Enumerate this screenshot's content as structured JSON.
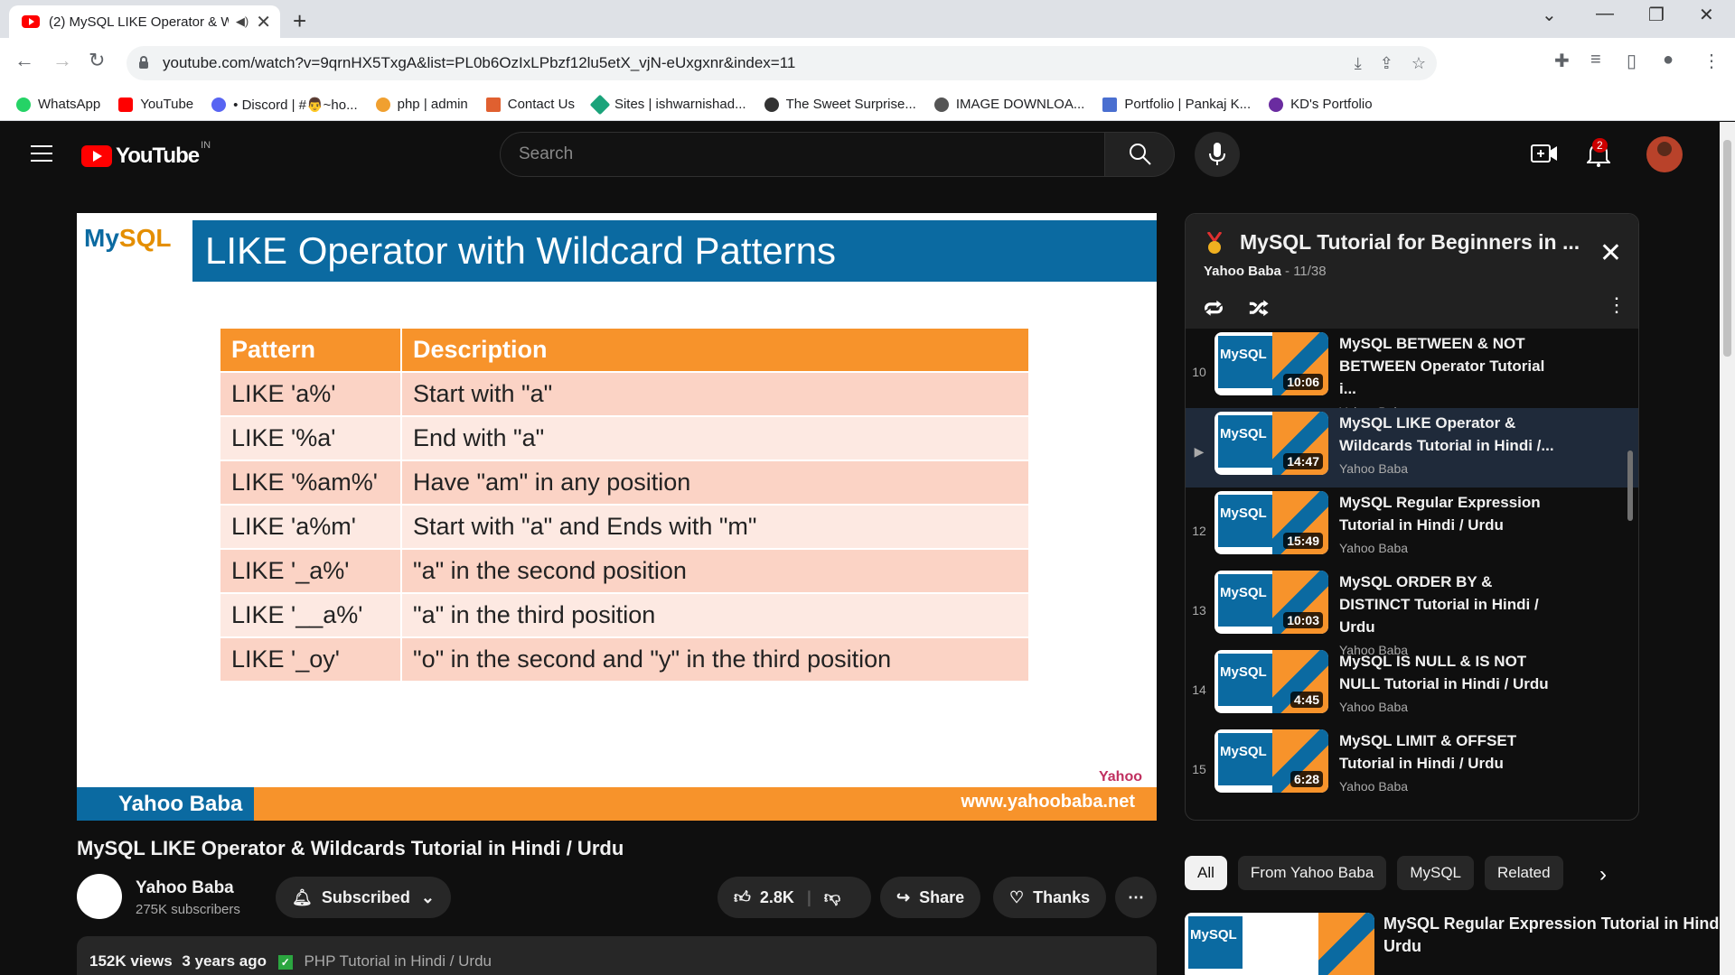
{
  "browser": {
    "tab_title": "(2) MySQL LIKE Operator & W",
    "url": "youtube.com/watch?v=9qrnHX5TxgA&list=PL0b6OzIxLPbzf12lu5etX_vjN-eUxgxnr&index=11",
    "bookmarks": [
      {
        "label": "WhatsApp",
        "color": "#25d366"
      },
      {
        "label": "YouTube",
        "color": "#ff0000"
      },
      {
        "label": "• Discord | #👨~ho...",
        "color": "#5865f2"
      },
      {
        "label": "php | admin",
        "color": "#f0a030"
      },
      {
        "label": "Contact Us",
        "color": "#e06030"
      },
      {
        "label": "Sites | ishwarnishad...",
        "color": "#1aa37a"
      },
      {
        "label": "The Sweet Surprise...",
        "color": "#333333"
      },
      {
        "label": "IMAGE DOWNLOA...",
        "color": "#555555"
      },
      {
        "label": "Portfolio | Pankaj K...",
        "color": "#4a6fd0"
      },
      {
        "label": "KD's Portfolio",
        "color": "#6a2ca0"
      }
    ]
  },
  "youtube": {
    "country": "IN",
    "search_placeholder": "Search",
    "notification_count": "2",
    "video": {
      "slide_title": "LIKE Operator with Wildcard Patterns",
      "logo_text": "My",
      "logo_text_sql": "SQL",
      "headers": [
        "Pattern",
        "Description"
      ],
      "rows": [
        [
          "LIKE 'a%'",
          "Start with \"a\""
        ],
        [
          "LIKE '%a'",
          "End with \"a\""
        ],
        [
          "LIKE '%am%'",
          "Have \"am\" in any position"
        ],
        [
          "LIKE 'a%m'",
          "Start with \"a\" and Ends with \"m\""
        ],
        [
          "LIKE '_a%'",
          "\"a\" in the second position"
        ],
        [
          "LIKE '__a%'",
          "\"a\" in the third position"
        ],
        [
          "LIKE '_oy'",
          "\"o\" in the second and \"y\" in the third position"
        ]
      ],
      "brand": "Yahoo Baba",
      "site": "www.yahoobaba.net",
      "watermark": "Yahoo"
    },
    "title": "MySQL LIKE Operator & Wildcards Tutorial in Hindi / Urdu",
    "channel": {
      "name": "Yahoo Baba",
      "subscribers": "275K subscribers",
      "subscribed_label": "Subscribed"
    },
    "actions": {
      "likes": "2.8K",
      "share": "Share",
      "thanks": "Thanks"
    },
    "description": {
      "views": "152K views",
      "age": "3 years ago",
      "tag": "PHP Tutorial in Hindi / Urdu"
    },
    "playlist": {
      "title": "MySQL Tutorial for Beginners in ...",
      "owner": "Yahoo Baba",
      "position": "- 11/38",
      "items": [
        {
          "idx": "10",
          "title": "MySQL BETWEEN & NOT BETWEEN Operator Tutorial i...",
          "channel": "Yahoo Baba",
          "duration": "10:06"
        },
        {
          "idx": "▶",
          "title": "MySQL LIKE Operator & Wildcards Tutorial in Hindi /...",
          "channel": "Yahoo Baba",
          "duration": "14:47"
        },
        {
          "idx": "12",
          "title": "MySQL Regular Expression Tutorial in Hindi / Urdu",
          "channel": "Yahoo Baba",
          "duration": "15:49"
        },
        {
          "idx": "13",
          "title": "MySQL ORDER BY & DISTINCT Tutorial in Hindi / Urdu",
          "channel": "Yahoo Baba",
          "duration": "10:03"
        },
        {
          "idx": "14",
          "title": "MySQL IS NULL & IS NOT NULL Tutorial in Hindi / Urdu",
          "channel": "Yahoo Baba",
          "duration": "4:45"
        },
        {
          "idx": "15",
          "title": "MySQL LIMIT & OFFSET Tutorial in Hindi / Urdu",
          "channel": "Yahoo Baba",
          "duration": "6:28"
        }
      ]
    },
    "chips": [
      "All",
      "From Yahoo Baba",
      "MySQL",
      "Related"
    ],
    "recommended": {
      "title": "MySQL Regular Expression Tutorial in Hindi / Urdu"
    }
  }
}
